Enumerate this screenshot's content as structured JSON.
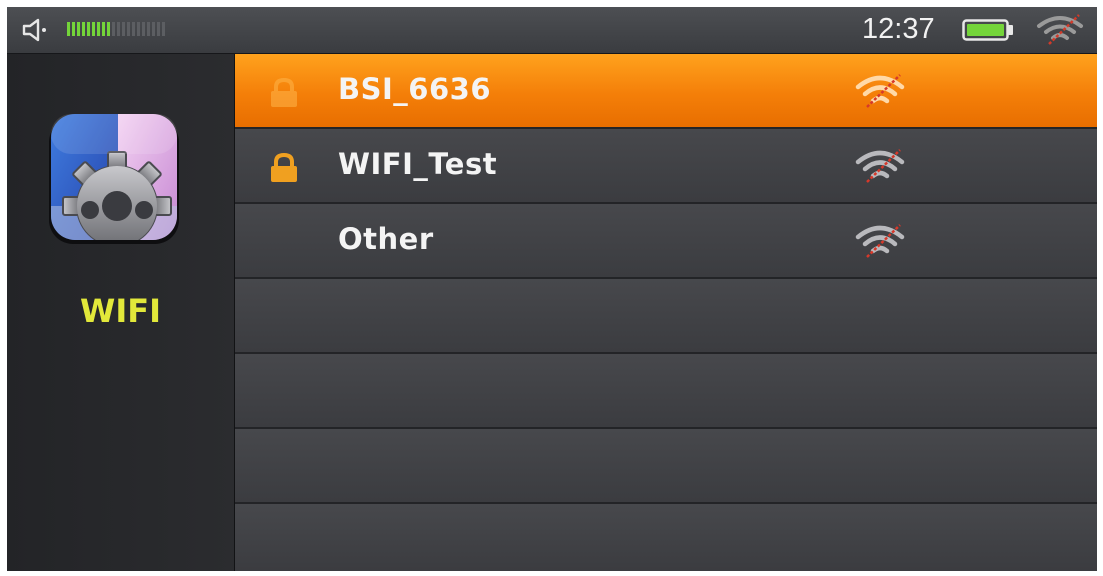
{
  "status_bar": {
    "volume_level": 0.45,
    "time": "12:37",
    "battery_color": "#74d43a",
    "icons": [
      "speaker-icon",
      "battery-icon",
      "wifi-signal-icon"
    ]
  },
  "sidebar": {
    "app_title": "WIFI",
    "app_icon": "settings-gear-icon",
    "title_color": "#e2e83a"
  },
  "networks": [
    {
      "name": "BSI_6636",
      "secured": true,
      "selected": true
    },
    {
      "name": "WIFI_Test",
      "secured": true,
      "selected": false
    },
    {
      "name": "Other",
      "secured": false,
      "selected": false
    }
  ],
  "colors": {
    "accent": "#f47f09",
    "lock": "#f0a020",
    "row": "#434448"
  }
}
